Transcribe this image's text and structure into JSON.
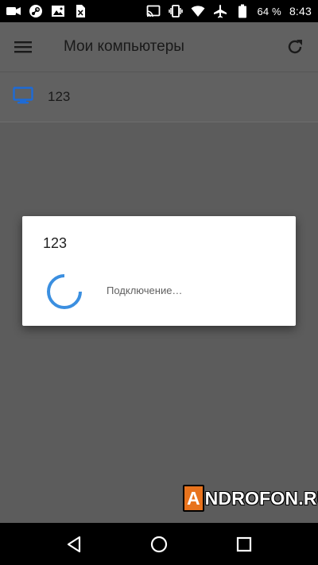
{
  "status_bar": {
    "left_icons": [
      "video-camera-icon",
      "steam-icon",
      "image-icon",
      "sim-error-icon"
    ],
    "right_icons": [
      "cast-icon",
      "vibrate-icon",
      "wifi-icon",
      "airplane-icon",
      "battery-icon"
    ],
    "battery_percent": "64 %",
    "time": "8:43"
  },
  "app_bar": {
    "title": "Мои компьютеры",
    "menu_icon": "hamburger-menu-icon",
    "refresh_icon": "refresh-icon"
  },
  "computers": [
    {
      "name": "123",
      "icon": "monitor-icon"
    }
  ],
  "dialog": {
    "title": "123",
    "message": "Подключение…"
  },
  "watermark": {
    "first_letter": "A",
    "rest": "NDROFON.RU"
  },
  "nav_bar": {
    "buttons": [
      "back-icon",
      "home-icon",
      "recents-icon"
    ]
  },
  "colors": {
    "accent_blue": "#1e6bd6",
    "spinner_blue": "#3b8fe0",
    "watermark_orange": "#e8731d"
  }
}
